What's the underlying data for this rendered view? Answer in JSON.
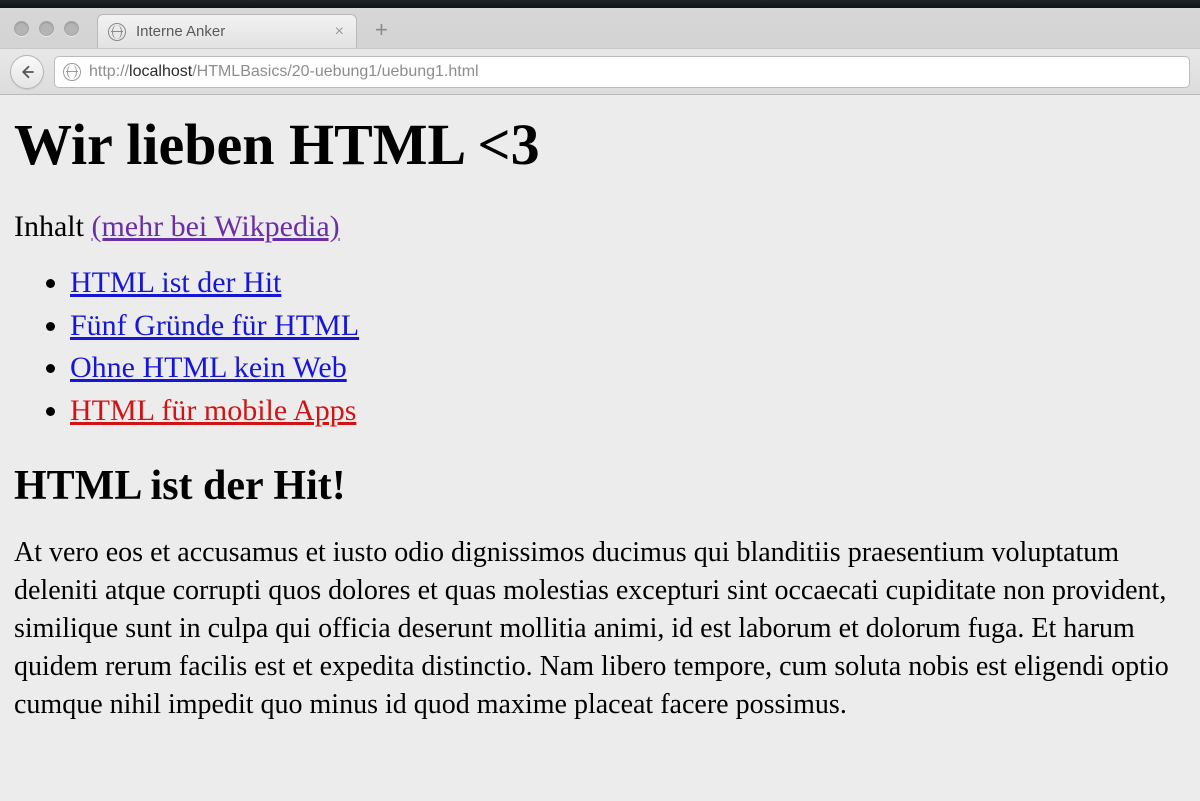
{
  "browser": {
    "tab_title": "Interne Anker",
    "url_protocol": "http://",
    "url_host": "localhost",
    "url_path": "/HTMLBasics/20-uebung1/uebung1.html"
  },
  "page": {
    "h1": "Wir lieben HTML <3",
    "sub_lead": "Inhalt ",
    "sub_link": "(mehr bei Wikpedia)",
    "toc": [
      "HTML ist der Hit",
      "Fünf Gründe für HTML",
      "Ohne HTML kein Web",
      "HTML für mobile Apps"
    ],
    "h2": "HTML ist der Hit!",
    "body_para": "At vero eos et accusamus et iusto odio dignissimos ducimus qui blanditiis praesentium voluptatum deleniti atque corrupti quos dolores et quas molestias excepturi sint occaecati cupiditate non provident, similique sunt in culpa qui officia deserunt mollitia animi, id est laborum et dolorum fuga. Et harum quidem rerum facilis est et expedita distinctio. Nam libero tempore, cum soluta nobis est eligendi optio cumque nihil impedit quo minus id quod maxime placeat facere possimus."
  }
}
